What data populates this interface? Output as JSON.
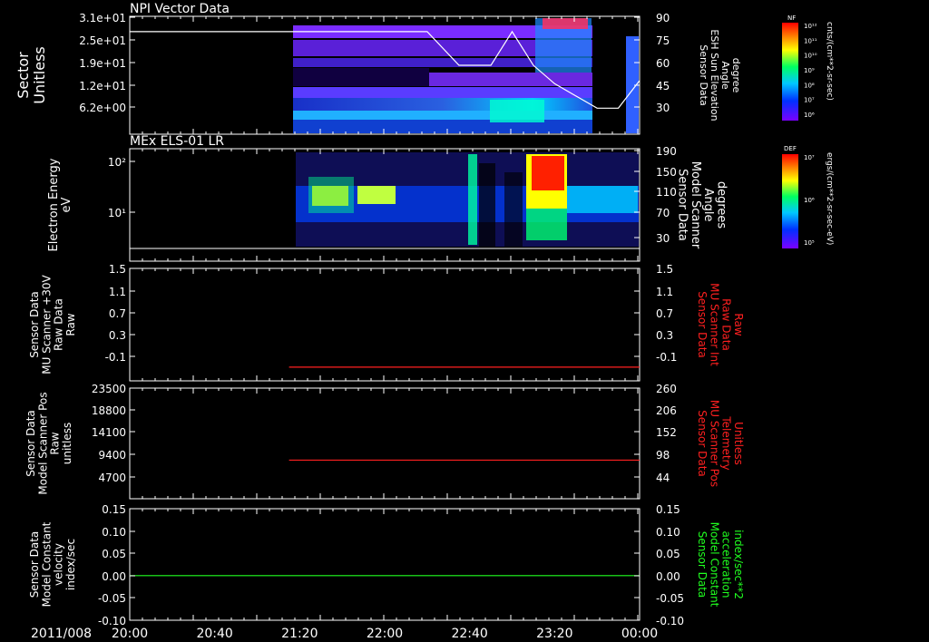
{
  "date_label": "2011/008",
  "colors": {
    "axis": "#ffffff",
    "red": "#ff2020",
    "green": "#20ff20"
  },
  "chart_data": [
    {
      "type": "heatmap",
      "title": "NPI Vector Data",
      "ylabel": [
        "Sector",
        "Unitless"
      ],
      "yticks": [
        "3.1e+01",
        "2.5e+01",
        "1.9e+01",
        "1.2e+01",
        "6.2e+00"
      ],
      "y2label": [
        "Sensor Data",
        "ESH Sun Elevation",
        "Angle",
        "degree"
      ],
      "y2ticks": [
        "90",
        "75",
        "60",
        "45",
        "30"
      ],
      "colorbar": {
        "label": "NF",
        "units": "cnts/(cm**2-sr-sec)",
        "ticks": [
          "10¹²",
          "10¹¹",
          "10¹⁰",
          "10⁹",
          "10⁸",
          "10⁷",
          "10⁶"
        ]
      },
      "overlay_line": {
        "x": [
          "20:00",
          "21:20",
          "22:20",
          "22:35",
          "22:50",
          "23:00",
          "23:10",
          "23:20",
          "23:40",
          "23:50",
          "00:00"
        ],
        "y": [
          82,
          82,
          82,
          60,
          60,
          82,
          60,
          48,
          32,
          32,
          50
        ]
      }
    },
    {
      "type": "heatmap",
      "title": "MEx ELS-01 LR",
      "ylabel": [
        "Electron Energy",
        "eV"
      ],
      "yticks": [
        "10²",
        "10¹"
      ],
      "y2label": [
        "Sensor Data",
        "Model Scanner",
        "Angle",
        "degrees"
      ],
      "y2ticks": [
        "190",
        "150",
        "110",
        "70",
        "30"
      ],
      "colorbar": {
        "label": "DEF",
        "units": "ergs/(cm**2-sr-sec-eV)",
        "ticks": [
          "10⁷",
          "10⁶",
          "10⁵"
        ]
      }
    },
    {
      "type": "line",
      "ylabel": [
        "Sensor Data",
        "MU Scanner +30V",
        "Raw Data",
        "Raw"
      ],
      "yticks": [
        "1.5",
        "1.1",
        "0.7",
        "0.3",
        "-0.1"
      ],
      "ylim": [
        -0.3,
        1.5
      ],
      "y2label": [
        "Sensor Data",
        "MU Scanner Int",
        "Raw Data",
        "Raw"
      ],
      "y2ticks": [
        "1.5",
        "1.1",
        "0.7",
        "0.3",
        "-0.1"
      ],
      "series": [
        {
          "x": [
            "21:15",
            "00:00"
          ],
          "values": [
            -0.08,
            -0.08
          ]
        }
      ]
    },
    {
      "type": "line",
      "ylabel": [
        "Sensor Data",
        "Model Scanner Pos",
        "Raw",
        "unitless"
      ],
      "yticks": [
        "23500",
        "18800",
        "14100",
        "9400",
        "4700"
      ],
      "ylim": [
        0,
        23500
      ],
      "y2label": [
        "Sensor Data",
        "MU Scanner Pos",
        "Telemetry",
        "Unitless"
      ],
      "y2ticks": [
        "260",
        "206",
        "152",
        "98",
        "44"
      ],
      "series": [
        {
          "x": [
            "21:15",
            "00:00"
          ],
          "values": [
            8200,
            8200
          ]
        }
      ]
    },
    {
      "type": "line",
      "ylabel": [
        "Sensor Data",
        "Model Constant",
        "velocity",
        "index/sec"
      ],
      "yticks": [
        "0.15",
        "0.10",
        "0.05",
        "0.00",
        "-0.05",
        "-0.10"
      ],
      "ylim": [
        -0.1,
        0.15
      ],
      "y2label": [
        "Sensor Data",
        "Model Constant",
        "acceleration",
        "index/sec**2"
      ],
      "y2ticks": [
        "0.15",
        "0.10",
        "0.05",
        "0.00",
        "-0.05",
        "-0.10"
      ],
      "series": [
        {
          "x": [
            "20:00",
            "00:00"
          ],
          "values": [
            0,
            0
          ]
        }
      ]
    }
  ],
  "xticks": [
    "20:00",
    "20:40",
    "21:20",
    "22:00",
    "22:40",
    "23:20",
    "00:00"
  ]
}
